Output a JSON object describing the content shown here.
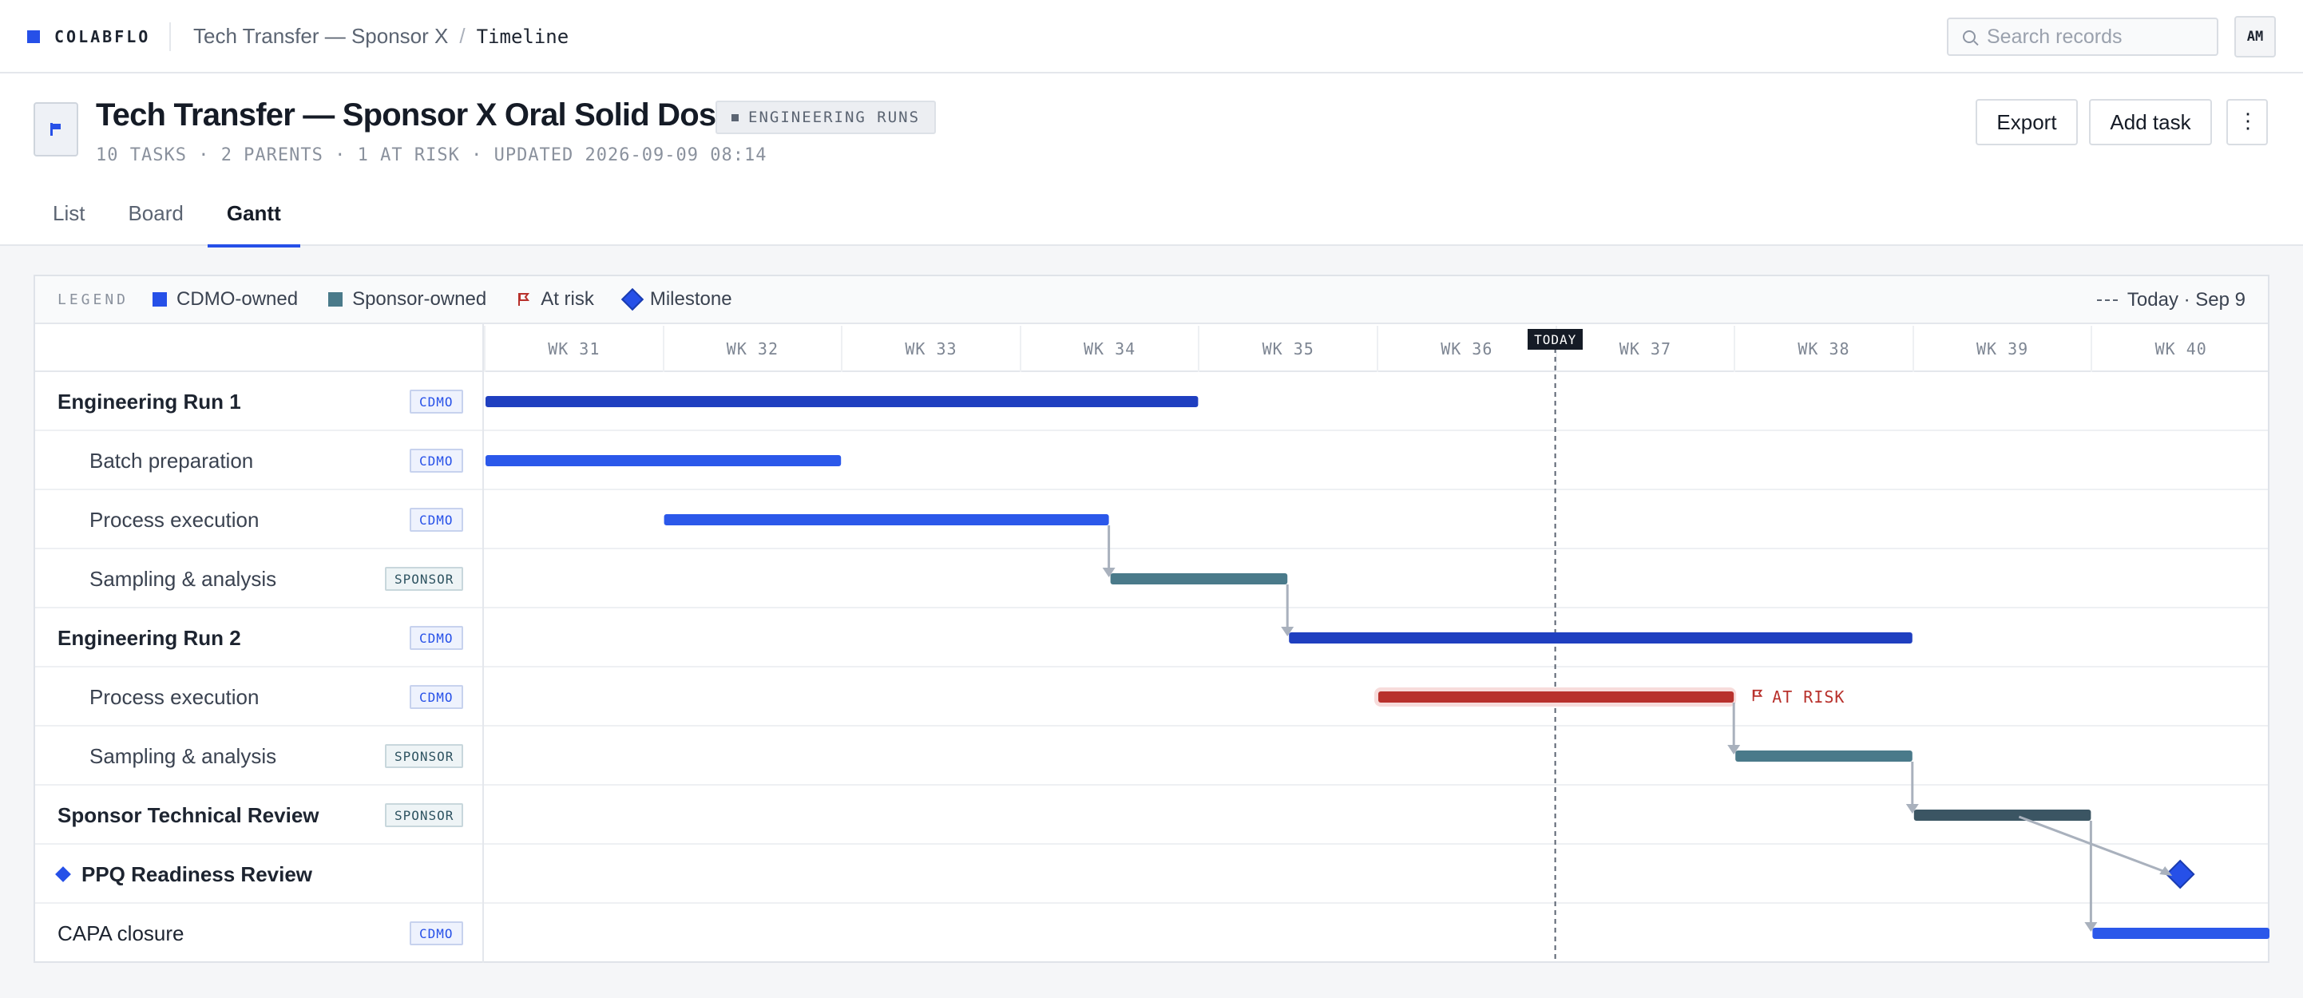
{
  "topbar": {
    "brand": "COLABFLO",
    "breadcrumb_project": "Tech Transfer — Sponsor X",
    "breadcrumb_sep": "/",
    "breadcrumb_current": "Timeline",
    "search_placeholder": "Search records",
    "avatar_initials": "AM"
  },
  "header": {
    "title": "Tech Transfer — Sponsor X Oral Solid Dosage",
    "tag": "ENGINEERING RUNS",
    "meta": "10 TASKS · 2 PARENTS · 1 AT RISK · UPDATED 2026-09-09 08:14",
    "export_label": "Export",
    "add_task_label": "Add task",
    "more_label": "⋮",
    "tabs": [
      {
        "label": "List",
        "active": false
      },
      {
        "label": "Board",
        "active": false
      },
      {
        "label": "Gantt",
        "active": true
      }
    ]
  },
  "legend": {
    "title": "LEGEND",
    "cdmo": "CDMO-owned",
    "sponsor": "Sponsor-owned",
    "at_risk": "At risk",
    "milestone": "Milestone",
    "today": "Today · Sep 9"
  },
  "colors": {
    "cdmo_parent": "#1f3fc0",
    "cdmo": "#2b58ea",
    "sponsor": "#4a7a8a",
    "sponsor_parent": "#3b5563",
    "at_risk": "#b8312c",
    "milestone": "#2650e8",
    "dependency": "#a9b1bd"
  },
  "timeline": {
    "weeks": [
      "WK 31",
      "WK 32",
      "WK 33",
      "WK 34",
      "WK 35",
      "WK 36",
      "WK 37",
      "WK 38",
      "WK 39",
      "WK 40"
    ],
    "today_label": "TODAY",
    "today_week": 6.0,
    "at_risk_label": "AT RISK"
  },
  "tasks": [
    {
      "name": "Engineering Run 1",
      "kind": "parent",
      "owner": "CDMO",
      "start": 0,
      "end": 4
    },
    {
      "name": "Batch preparation",
      "kind": "child",
      "owner": "CDMO",
      "start": 0,
      "end": 2
    },
    {
      "name": "Process execution",
      "kind": "child",
      "owner": "CDMO",
      "start": 1,
      "end": 3.5
    },
    {
      "name": "Sampling & analysis",
      "kind": "child",
      "owner": "SPONSOR",
      "start": 3.5,
      "end": 4.5
    },
    {
      "name": "Engineering Run 2",
      "kind": "parent",
      "owner": "CDMO",
      "start": 4.5,
      "end": 8
    },
    {
      "name": "Process execution",
      "kind": "child",
      "owner": "CDMO",
      "start": 5,
      "end": 7,
      "at_risk": true
    },
    {
      "name": "Sampling & analysis",
      "kind": "child",
      "owner": "SPONSOR",
      "start": 7,
      "end": 8
    },
    {
      "name": "Sponsor Technical Review",
      "kind": "parent",
      "owner": "SPONSOR",
      "start": 8,
      "end": 9
    },
    {
      "name": "PPQ Readiness Review",
      "kind": "milestone",
      "owner": "",
      "start": 9.5,
      "end": 9.5
    },
    {
      "name": "CAPA closure",
      "kind": "plain",
      "owner": "CDMO",
      "start": 9,
      "end": 10
    }
  ]
}
